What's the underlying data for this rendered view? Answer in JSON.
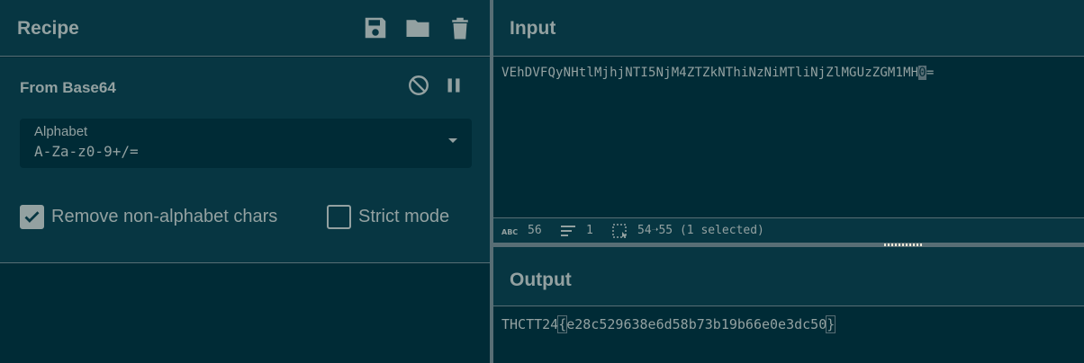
{
  "recipe": {
    "title": "Recipe",
    "icons": [
      "save-icon",
      "folder-icon",
      "trash-icon"
    ],
    "operation": {
      "name": "From Base64",
      "icons": [
        "disable-icon",
        "pause-icon"
      ],
      "alphabet": {
        "label": "Alphabet",
        "value": "A-Za-z0-9+/="
      },
      "remove_non_alphabet": {
        "label": "Remove non-alphabet chars",
        "checked": true
      },
      "strict_mode": {
        "label": "Strict mode",
        "checked": false
      }
    }
  },
  "input": {
    "title": "Input",
    "text_before_cursor": "VEhDVFQyNHtlMjhjNTI5NjM4ZTZkNThiNzNiMTliNjZlMGUzZGM1MH",
    "text_cursor_char": "0",
    "text_after_cursor": "=",
    "status": {
      "length": "56",
      "lines": "1",
      "selection": "54➝55 (1 selected)"
    }
  },
  "output": {
    "title": "Output",
    "text_prefix": "THCTT24",
    "text_open_brace": "{",
    "text_inner": "e28c529638e6d58b73b19b66e0e3dc50",
    "text_close_brace": "}"
  },
  "colors": {
    "background": "#002b36",
    "panel": "#073642",
    "border": "#586e75",
    "text": "#93a1a1"
  }
}
